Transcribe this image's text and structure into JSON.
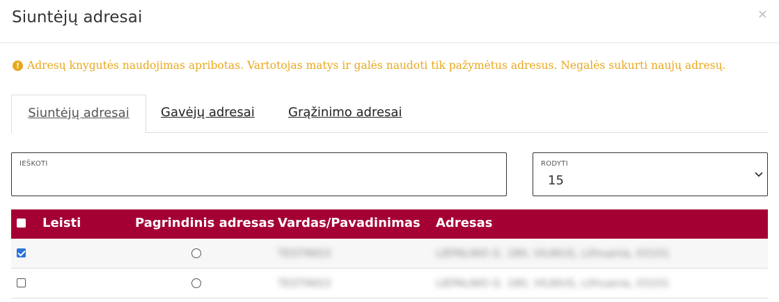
{
  "dialog": {
    "title": "Siuntėjų adresai",
    "close_symbol": "×"
  },
  "notice": {
    "icon": "exclamation-circle-icon",
    "text": "Adresų knygutės naudojimas apribotas. Vartotojas matys ir galės naudoti tik pažymėtus adresus. Negalės sukurti naujų adresų.",
    "color": "#e9a81c"
  },
  "tabs": [
    {
      "label": "Siuntėjų adresai",
      "active": true
    },
    {
      "label": "Gavėjų adresai",
      "active": false
    },
    {
      "label": "Grąžinimo adresai",
      "active": false
    }
  ],
  "search": {
    "label": "IEŠKOTI",
    "value": ""
  },
  "show": {
    "label": "RODYTI",
    "value": "15"
  },
  "table": {
    "header_color": "#a50034",
    "columns": [
      "Leisti",
      "Pagrindinis adresas",
      "Vardas/Pavadinimas",
      "Adresas"
    ],
    "rows": [
      {
        "allowed": true,
        "primary": false,
        "name": "TESTINIS3",
        "address": "LIEPALNIO G. 180, VILNIUS, Lithuania, 03101"
      },
      {
        "allowed": false,
        "primary": false,
        "name": "TESTINIS3",
        "address": "LIEPALNIO G. 180, VILNIUS, Lithuania, 03101"
      }
    ]
  }
}
